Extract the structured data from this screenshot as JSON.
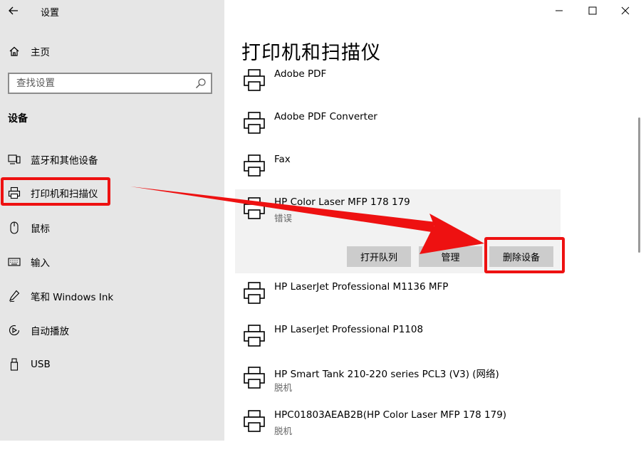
{
  "window": {
    "title": "设置",
    "controls": {
      "minimize_icon": "minimize-icon",
      "maximize_icon": "maximize-icon",
      "close_icon": "close-icon"
    }
  },
  "sidebar": {
    "home_label": "主页",
    "search_placeholder": "查找设置",
    "section_title": "设备",
    "items": [
      {
        "label": "蓝牙和其他设备",
        "icon": "bluetooth-devices-icon"
      },
      {
        "label": "打印机和扫描仪",
        "icon": "printer-icon",
        "selected": true
      },
      {
        "label": "鼠标",
        "icon": "mouse-icon"
      },
      {
        "label": "输入",
        "icon": "keyboard-icon"
      },
      {
        "label": "笔和 Windows Ink",
        "icon": "pen-icon"
      },
      {
        "label": "自动播放",
        "icon": "autoplay-icon"
      },
      {
        "label": "USB",
        "icon": "usb-icon"
      }
    ]
  },
  "main": {
    "title": "打印机和扫描仪",
    "printers": [
      {
        "name": "Adobe PDF",
        "status": ""
      },
      {
        "name": "Adobe PDF Converter",
        "status": ""
      },
      {
        "name": "Fax",
        "status": ""
      },
      {
        "name": "HP Color Laser MFP 178 179",
        "status": "错误",
        "selected": true
      },
      {
        "name": "HP LaserJet Professional M1136 MFP",
        "status": ""
      },
      {
        "name": "HP LaserJet Professional P1108",
        "status": ""
      },
      {
        "name": "HP Smart Tank 210-220 series PCL3 (V3) (网络)",
        "status": "脱机"
      },
      {
        "name": "HPC01803AEAB2B(HP Color Laser MFP 178 179)",
        "status": "脱机"
      }
    ],
    "actions": {
      "open_queue": "打开队列",
      "manage": "管理",
      "remove_device": "删除设备"
    }
  },
  "colors": {
    "sidebar_bg": "#e6e6e6",
    "highlight": "#ee1111",
    "button_bg": "#cccccc"
  }
}
